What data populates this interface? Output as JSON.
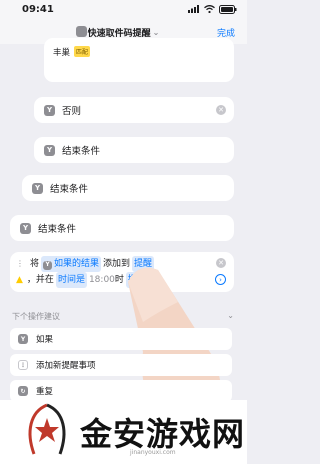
{
  "status_bar": {
    "time": "09:41"
  },
  "nav": {
    "title": "快速取件码提醒",
    "chevron": "⌄",
    "done_label": "完成"
  },
  "top_card": {
    "text": "丰巢",
    "tag": "匹配"
  },
  "actions": [
    {
      "badge": "Y",
      "label": "否则"
    },
    {
      "badge": "Y",
      "label": "结束条件"
    },
    {
      "badge": "Y",
      "label": "结束条件"
    },
    {
      "badge": "Y",
      "label": "结束条件"
    }
  ],
  "add_reminder": {
    "word_jiang": "将",
    "token_if_result": "如果的结果",
    "word_add_to": "添加到",
    "token_reminder": "提醒",
    "word_and_at": "，并在",
    "token_time": "时间是",
    "time_text": "18:00",
    "word_time_at": "时",
    "token_reminder2": "提醒"
  },
  "suggestions": {
    "header": "下个操作建议",
    "items": [
      {
        "label": "如果"
      },
      {
        "label": "添加新提醒事项"
      },
      {
        "label": "重复"
      }
    ]
  },
  "watermark": {
    "text": "金安游戏网",
    "url": "jinanyouxi.com"
  },
  "colors": {
    "accent": "#0a7aff",
    "background": "#eeeef3",
    "warning": "#ffcc00"
  },
  "icons": [
    "signal-icon",
    "wifi-icon",
    "battery-icon",
    "close-icon",
    "warning-icon",
    "arrow-right-circle-icon",
    "chevron-down-icon",
    "repeat-icon"
  ]
}
